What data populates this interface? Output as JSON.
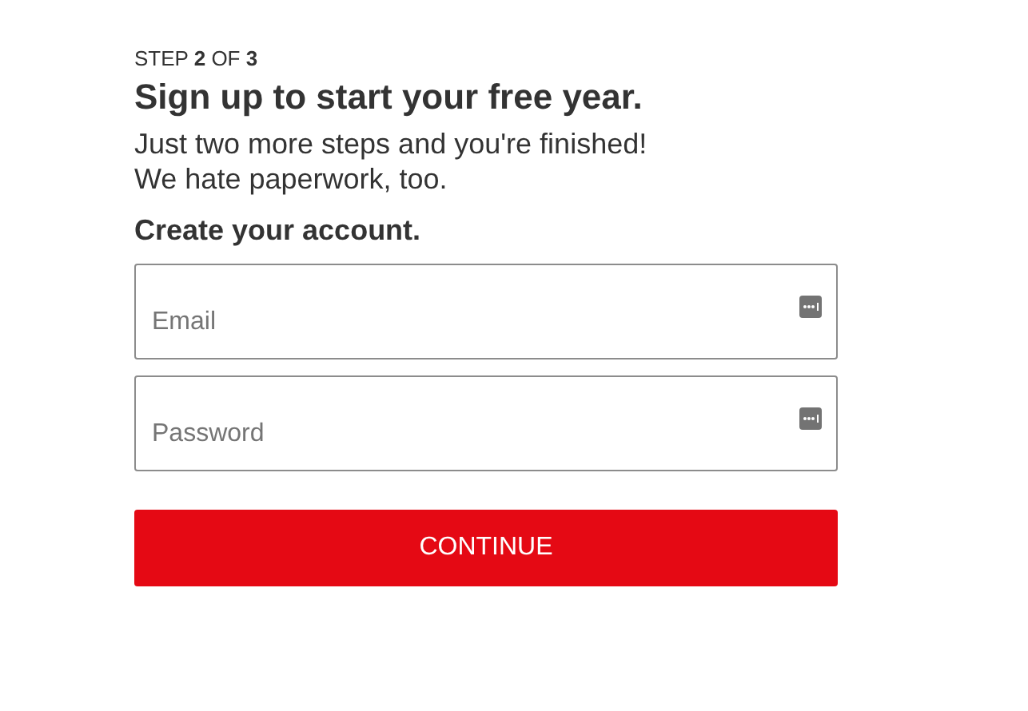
{
  "step": "STEP **2** OF **3**",
  "title": "Sign up to start your free year.",
  "subtitle_lines": [
    "Just two more steps and you're finished!",
    "We hate paperwork, too."
  ],
  "form_heading": "Create your account.",
  "fields": [
    {
      "placeholder": "Email"
    },
    {
      "placeholder": "Password"
    }
  ],
  "button": "CONTINUE"
}
